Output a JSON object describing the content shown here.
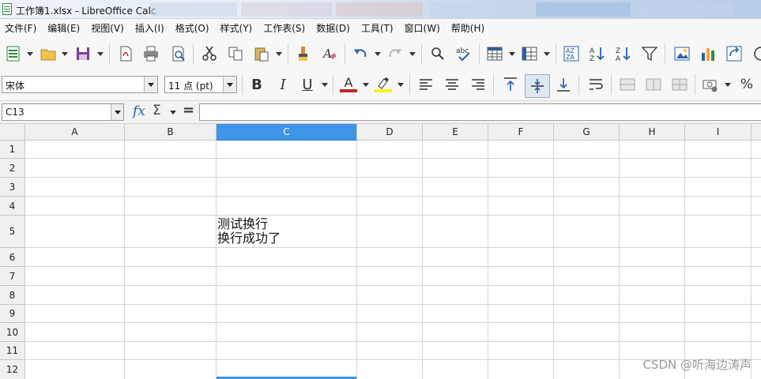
{
  "window": {
    "title": "工作簿1.xlsx - LibreOffice Calc"
  },
  "menubar": {
    "items": [
      "文件(F)",
      "编辑(E)",
      "视图(V)",
      "插入(I)",
      "格式(O)",
      "样式(Y)",
      "工作表(S)",
      "数据(D)",
      "工具(T)",
      "窗口(W)",
      "帮助(H)"
    ]
  },
  "toolbar2": {
    "font_name": "宋体",
    "font_size": "11 点 (pt)",
    "bold_label": "B",
    "italic_label": "I",
    "underline_label": "U",
    "font_color_label": "A",
    "percent_label": "%",
    "colors": {
      "font_color": "#c0262d",
      "highlight_color": "#f5f500"
    }
  },
  "formulabar": {
    "cell_ref": "C13",
    "fx_label": "fx",
    "sum_label": "Σ",
    "equals_label": "=",
    "formula": ""
  },
  "sheet": {
    "columns": [
      "A",
      "B",
      "C",
      "D",
      "E",
      "F",
      "G",
      "H",
      "I"
    ],
    "selected_column": "C",
    "rows": [
      "1",
      "2",
      "3",
      "4",
      "5",
      "6",
      "7",
      "8",
      "9",
      "10",
      "11",
      "12"
    ],
    "cells": {
      "C5": {
        "line1": "测试换行",
        "line2": "换行成功了"
      }
    }
  },
  "watermark": "CSDN @听海边涛声",
  "accent_color": "#3e94e6"
}
